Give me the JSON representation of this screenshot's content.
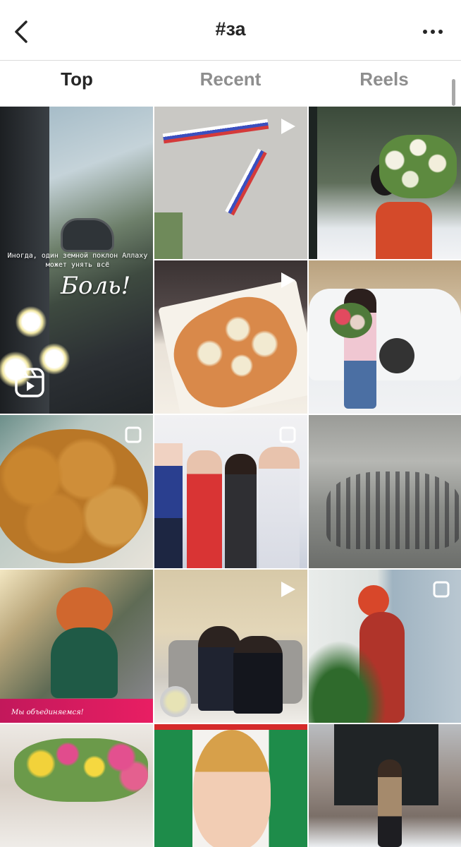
{
  "header": {
    "title": "#за",
    "back_icon": "chevron-left-icon",
    "more_icon": "more-horizontal-icon"
  },
  "tabs": [
    {
      "label": "Top",
      "active": true
    },
    {
      "label": "Recent",
      "active": false
    },
    {
      "label": "Reels",
      "active": false
    }
  ],
  "posts": [
    {
      "badge": "reels-icon",
      "overlay_small": "Иногда, один земной поклон Аллаху может унять всё",
      "overlay_big": "Боль!"
    },
    {
      "badge": "video-icon"
    },
    {
      "badge": ""
    },
    {
      "badge": "video-icon"
    },
    {
      "badge": ""
    },
    {
      "badge": "carousel-icon"
    },
    {
      "badge": "carousel-icon"
    },
    {
      "badge": ""
    },
    {
      "badge": "",
      "overlay_caption": "Мы объединяемся!"
    },
    {
      "badge": "video-icon"
    },
    {
      "badge": "carousel-icon"
    },
    {
      "badge": ""
    },
    {
      "badge": ""
    },
    {
      "badge": ""
    }
  ],
  "colors": {
    "text_primary": "#262626",
    "text_secondary": "#8e8e8e",
    "divider": "#dbdbdb"
  }
}
